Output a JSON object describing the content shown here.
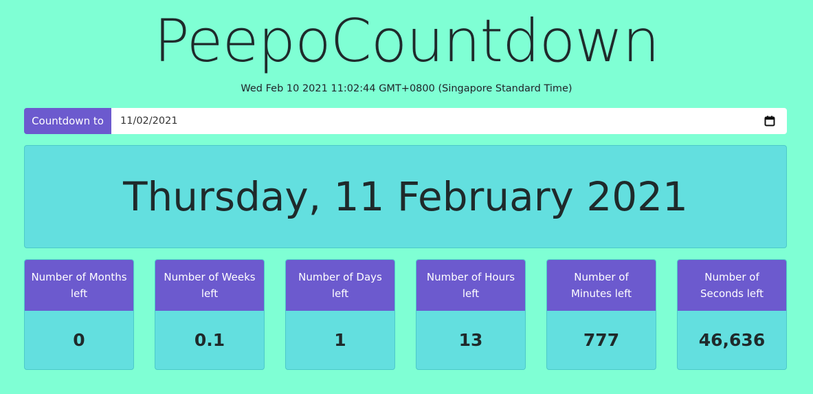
{
  "app": {
    "title": "PeepoCountdown",
    "current_time": "Wed Feb 10 2021 11:02:44 GMT+0800 (Singapore Standard Time)"
  },
  "countdown_input": {
    "label": "Countdown to",
    "value": "11/02/2021",
    "icon": "calendar-icon"
  },
  "target": {
    "display": "Thursday, 11 February 2021"
  },
  "stats": [
    {
      "label": "Number of Months left",
      "value": "0"
    },
    {
      "label": "Number of Weeks left",
      "value": "0.1"
    },
    {
      "label": "Number of Days left",
      "value": "1"
    },
    {
      "label": "Number of Hours left",
      "value": "13"
    },
    {
      "label": "Number of Minutes left",
      "value": "777"
    },
    {
      "label": "Number of Seconds left",
      "value": "46,636"
    }
  ],
  "colors": {
    "page_background": "#7fffd4",
    "accent_purple": "#6c5ace",
    "panel_cyan": "#63dfdf"
  }
}
